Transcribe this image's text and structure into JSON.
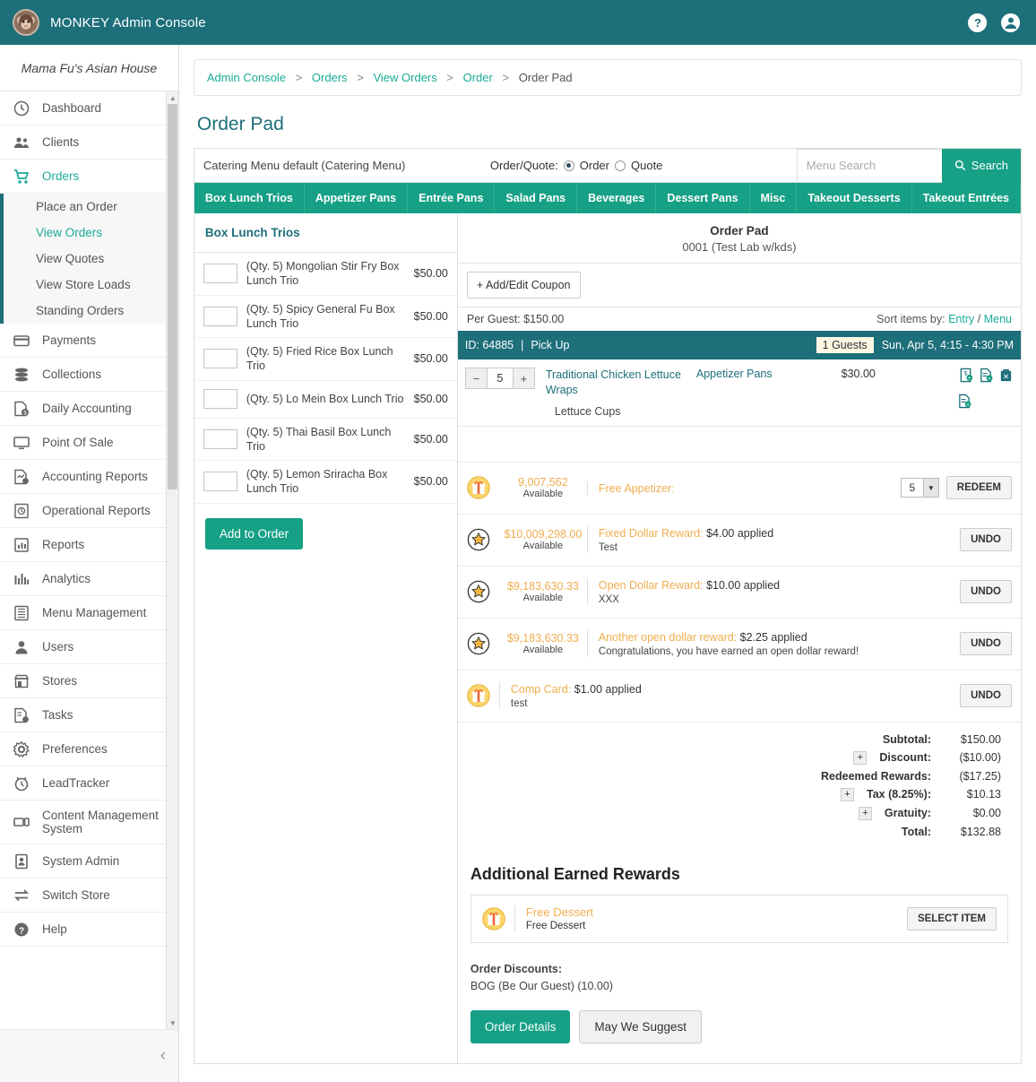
{
  "topbar": {
    "app_title": "MONKEY Admin Console",
    "logo_icon": "monkey-logo",
    "help_icon": "?",
    "account_icon": "●"
  },
  "sidebar": {
    "store_name": "Mama Fu's Asian House",
    "items": [
      {
        "label": "Dashboard",
        "icon": "dashboard-icon",
        "active": false
      },
      {
        "label": "Clients",
        "icon": "clients-icon",
        "active": false
      },
      {
        "label": "Orders",
        "icon": "cart-icon",
        "active": true
      },
      {
        "label": "Payments",
        "icon": "payments-icon",
        "active": false
      },
      {
        "label": "Collections",
        "icon": "collections-icon",
        "active": false
      },
      {
        "label": "Daily Accounting",
        "icon": "daily-accounting-icon",
        "active": false
      },
      {
        "label": "Point Of Sale",
        "icon": "point-of-sale-icon",
        "active": false
      },
      {
        "label": "Accounting Reports",
        "icon": "accounting-reports-icon",
        "active": false
      },
      {
        "label": "Operational Reports",
        "icon": "operational-reports-icon",
        "active": false
      },
      {
        "label": "Reports",
        "icon": "reports-icon",
        "active": false
      },
      {
        "label": "Analytics",
        "icon": "analytics-icon",
        "active": false
      },
      {
        "label": "Menu Management",
        "icon": "menu-management-icon",
        "active": false
      },
      {
        "label": "Users",
        "icon": "users-icon",
        "active": false
      },
      {
        "label": "Stores",
        "icon": "stores-icon",
        "active": false
      },
      {
        "label": "Tasks",
        "icon": "tasks-icon",
        "active": false
      },
      {
        "label": "Preferences",
        "icon": "gear-icon",
        "active": false
      },
      {
        "label": "LeadTracker",
        "icon": "clock-icon",
        "active": false
      },
      {
        "label": "Content Management System",
        "icon": "cms-icon",
        "active": false
      },
      {
        "label": "System Admin",
        "icon": "system-admin-icon",
        "active": false
      },
      {
        "label": "Switch Store",
        "icon": "switch-store-icon",
        "active": false
      },
      {
        "label": "Help",
        "icon": "help-icon",
        "active": false
      }
    ],
    "submenu": [
      {
        "label": "Place an Order",
        "active": false
      },
      {
        "label": "View Orders",
        "active": true
      },
      {
        "label": "View Quotes",
        "active": false
      },
      {
        "label": "View Store Loads",
        "active": false
      },
      {
        "label": "Standing Orders",
        "active": false
      }
    ],
    "collapse_icon": "chevron-left-icon"
  },
  "breadcrumb": {
    "items": [
      "Admin Console",
      "Orders",
      "View Orders",
      "Order"
    ],
    "current": "Order Pad",
    "separator": ">"
  },
  "page": {
    "title": "Order Pad"
  },
  "toolbar": {
    "menu_label": "Catering Menu default (Catering Menu)",
    "order_quote_label": "Order/Quote:",
    "order_option": "Order",
    "quote_option": "Quote",
    "selected_option": "Order",
    "search_placeholder": "Menu Search",
    "search_value": "",
    "search_button": "Search",
    "search_icon": "search-icon"
  },
  "tabs": [
    "Box Lunch Trios",
    "Appetizer Pans",
    "Entrée Pans",
    "Salad Pans",
    "Beverages",
    "Dessert Pans",
    "Misc",
    "Takeout Desserts",
    "Takeout Entrées"
  ],
  "catalog": {
    "heading": "Box Lunch Trios",
    "items": [
      {
        "name": "(Qty. 5) Mongolian Stir Fry Box Lunch Trio",
        "price": "$50.00",
        "qty": ""
      },
      {
        "name": "(Qty. 5) Spicy General Fu Box Lunch Trio",
        "price": "$50.00",
        "qty": ""
      },
      {
        "name": "(Qty. 5) Fried Rice Box Lunch Trio",
        "price": "$50.00",
        "qty": ""
      },
      {
        "name": "(Qty. 5) Lo Mein Box Lunch Trio",
        "price": "$50.00",
        "qty": ""
      },
      {
        "name": "(Qty. 5) Thai Basil Box Lunch Trio",
        "price": "$50.00",
        "qty": ""
      },
      {
        "name": "(Qty. 5) Lemon Sriracha Box Lunch Trio",
        "price": "$50.00",
        "qty": ""
      }
    ],
    "add_button": "Add to Order"
  },
  "orderpad": {
    "title": "Order Pad",
    "subtitle": "0001 (Test Lab w/kds)",
    "coupon_button": "+ Add/Edit Coupon",
    "per_guest": "Per Guest: $150.00",
    "sort_label": "Sort items by:",
    "sort_entry": "Entry",
    "sort_divider": "/",
    "sort_menu": "Menu",
    "id_text": "ID: 64885",
    "pipe": "|",
    "fulfillment": "Pick Up",
    "guests_badge": "1 Guests",
    "datetime": "Sun, Apr 5, 4:15 - 4:30 PM"
  },
  "line_items": [
    {
      "qty": "5",
      "minus": "−",
      "plus": "+",
      "name": "Traditional Chicken Lettuce Wraps",
      "sub_name": "Lettuce Cups",
      "category": "Appetizer Pans",
      "price": "$30.00",
      "icons": [
        "price-edit-icon",
        "add-note-icon",
        "delete-icon",
        "sub-note-icon"
      ]
    }
  ],
  "rewards": [
    {
      "icon": "gift-icon",
      "amount": "9,007,562",
      "available": "Available",
      "title": "Free Appetizer:",
      "detail": "",
      "select_value": "5",
      "action": "REDEEM"
    },
    {
      "icon": "star-icon",
      "amount": "$10,009,298.00",
      "available": "Available",
      "title": "Fixed Dollar Reward:",
      "applied": "$4.00 applied",
      "detail": "Test",
      "action": "UNDO"
    },
    {
      "icon": "star-icon",
      "amount": "$9,183,630.33",
      "available": "Available",
      "title": "Open Dollar Reward:",
      "applied": "$10.00 applied",
      "detail": "XXX",
      "action": "UNDO"
    },
    {
      "icon": "star-icon",
      "amount": "$9,183,630.33",
      "available": "Available",
      "title": "Another open dollar reward:",
      "applied": "$2.25 applied",
      "detail": "Congratulations, you have earned an open dollar reward!",
      "action": "UNDO"
    },
    {
      "icon": "gift-icon",
      "amount": "",
      "available": "",
      "title": "Comp Card:",
      "applied": "$1.00 applied",
      "detail": "test",
      "action": "UNDO"
    }
  ],
  "totals": [
    {
      "label": "Subtotal:",
      "value": "$150.00",
      "expandable": false
    },
    {
      "label": "Discount:",
      "value": "($10.00)",
      "expandable": true
    },
    {
      "label": "Redeemed Rewards:",
      "value": "($17.25)",
      "expandable": false
    },
    {
      "label": "Tax (8.25%):",
      "value": "$10.13",
      "expandable": true
    },
    {
      "label": "Gratuity:",
      "value": "$0.00",
      "expandable": true
    },
    {
      "label": "Total:",
      "value": "$132.88",
      "expandable": false
    }
  ],
  "earned_rewards": {
    "heading": "Additional Earned Rewards",
    "items": [
      {
        "icon": "gift-icon",
        "title": "Free Dessert",
        "detail": "Free Dessert",
        "action": "SELECT ITEM"
      }
    ]
  },
  "order_discounts": {
    "label": "Order Discounts:",
    "value": "BOG (Be Our Guest)   (10.00)"
  },
  "footer_buttons": {
    "primary": "Order Details",
    "secondary": "May We Suggest"
  },
  "colors": {
    "header_teal": "#1d6f7a",
    "accent_teal": "#16a085",
    "link_teal": "#1aab96",
    "reward_orange": "#f0ad4e"
  }
}
